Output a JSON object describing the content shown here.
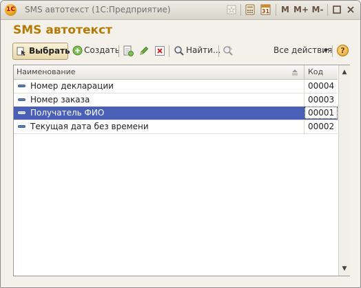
{
  "window": {
    "title": "SMS автотекст  (1С:Предприятие)",
    "app_icon_label": "1С",
    "buttons": {
      "memory_m": "M",
      "memory_plus": "M+",
      "memory_minus": "M-"
    }
  },
  "heading": "SMS автотекст",
  "toolbar": {
    "choose_label": "Выбрать",
    "create_label": "Создать",
    "find_label": "Найти...",
    "all_actions_label": "Все действия",
    "help_label": "?"
  },
  "grid": {
    "columns": {
      "name": "Наименование",
      "code": "Код"
    },
    "rows": [
      {
        "name": "Номер декларации",
        "code": "00004",
        "selected": false
      },
      {
        "name": "Номер заказа",
        "code": "00003",
        "selected": false
      },
      {
        "name": "Получатель ФИО",
        "code": "00001",
        "selected": true
      },
      {
        "name": "Текущая дата без времени",
        "code": "00002",
        "selected": false
      }
    ]
  },
  "colors": {
    "accent": "#b57a00",
    "selection": "#4a5fb6"
  }
}
